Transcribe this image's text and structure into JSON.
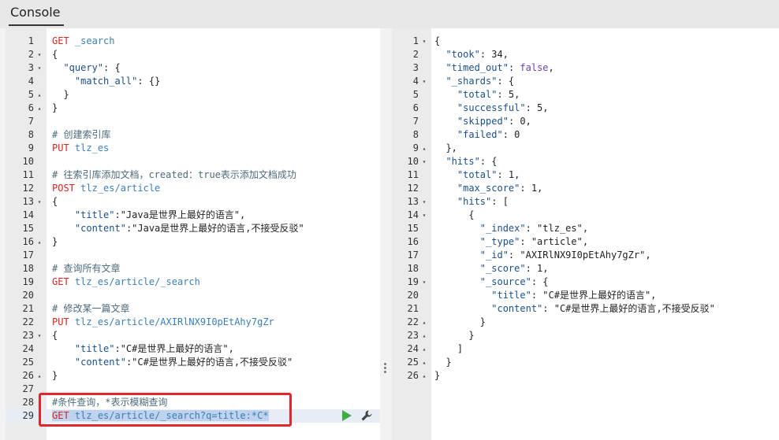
{
  "console": {
    "tab_label": "Console"
  },
  "editor": {
    "lines": [
      {
        "n": "1",
        "fold": "",
        "parts": [
          [
            "m",
            "GET"
          ],
          [
            "s",
            " "
          ],
          [
            "u",
            "_search"
          ]
        ]
      },
      {
        "n": "2",
        "fold": "▾",
        "parts": [
          [
            "s",
            "{"
          ]
        ]
      },
      {
        "n": "3",
        "fold": "▾",
        "parts": [
          [
            "s",
            "  "
          ],
          [
            "k",
            "\"query\""
          ],
          [
            "s",
            ": {"
          ]
        ]
      },
      {
        "n": "4",
        "fold": "",
        "parts": [
          [
            "s",
            "    "
          ],
          [
            "k",
            "\"match_all\""
          ],
          [
            "s",
            ": {}"
          ]
        ]
      },
      {
        "n": "5",
        "fold": "▴",
        "parts": [
          [
            "s",
            "  }"
          ]
        ]
      },
      {
        "n": "6",
        "fold": "▴",
        "parts": [
          [
            "s",
            "}"
          ]
        ]
      },
      {
        "n": "7",
        "fold": "",
        "parts": []
      },
      {
        "n": "8",
        "fold": "",
        "parts": [
          [
            "c",
            "# 创建索引库"
          ]
        ]
      },
      {
        "n": "9",
        "fold": "",
        "parts": [
          [
            "m",
            "PUT"
          ],
          [
            "s",
            " "
          ],
          [
            "u",
            "tlz_es"
          ]
        ]
      },
      {
        "n": "10",
        "fold": "",
        "parts": []
      },
      {
        "n": "11",
        "fold": "",
        "parts": [
          [
            "c",
            "# 往索引库添加文档，created：true表示添加文档成功"
          ]
        ]
      },
      {
        "n": "12",
        "fold": "",
        "parts": [
          [
            "m",
            "POST"
          ],
          [
            "s",
            " "
          ],
          [
            "u",
            "tlz_es/article"
          ]
        ]
      },
      {
        "n": "13",
        "fold": "▾",
        "parts": [
          [
            "s",
            "{"
          ]
        ]
      },
      {
        "n": "14",
        "fold": "",
        "parts": [
          [
            "s",
            "    "
          ],
          [
            "k",
            "\"title\""
          ],
          [
            "s",
            ":\"Java是世界上最好的语言\","
          ]
        ]
      },
      {
        "n": "15",
        "fold": "",
        "parts": [
          [
            "s",
            "    "
          ],
          [
            "k",
            "\"content\""
          ],
          [
            "s",
            ":\"Java是世界上最好的语言,不接受反驳\""
          ]
        ]
      },
      {
        "n": "16",
        "fold": "▴",
        "parts": [
          [
            "s",
            "}"
          ]
        ]
      },
      {
        "n": "17",
        "fold": "",
        "parts": []
      },
      {
        "n": "18",
        "fold": "",
        "parts": [
          [
            "c",
            "# 查询所有文章"
          ]
        ]
      },
      {
        "n": "19",
        "fold": "",
        "parts": [
          [
            "m",
            "GET"
          ],
          [
            "s",
            " "
          ],
          [
            "u",
            "tlz_es/article/_search"
          ]
        ]
      },
      {
        "n": "20",
        "fold": "",
        "parts": []
      },
      {
        "n": "21",
        "fold": "",
        "parts": [
          [
            "c",
            "# 修改某一篇文章"
          ]
        ]
      },
      {
        "n": "22",
        "fold": "",
        "parts": [
          [
            "m",
            "PUT"
          ],
          [
            "s",
            " "
          ],
          [
            "u",
            "tlz_es/article/AXIRlNX9I0pEtAhy7gZr"
          ]
        ]
      },
      {
        "n": "23",
        "fold": "▾",
        "parts": [
          [
            "s",
            "{"
          ]
        ]
      },
      {
        "n": "24",
        "fold": "",
        "parts": [
          [
            "s",
            "    "
          ],
          [
            "k",
            "\"title\""
          ],
          [
            "s",
            ":\"C#是世界上最好的语言\","
          ]
        ]
      },
      {
        "n": "25",
        "fold": "",
        "parts": [
          [
            "s",
            "    "
          ],
          [
            "k",
            "\"content\""
          ],
          [
            "s",
            ":\"C#是世界上最好的语言,不接受反驳\""
          ]
        ]
      },
      {
        "n": "26",
        "fold": "▴",
        "parts": [
          [
            "s",
            "}"
          ]
        ]
      },
      {
        "n": "27",
        "fold": "",
        "parts": []
      },
      {
        "n": "28",
        "fold": "",
        "parts": [
          [
            "c",
            "#条件查询，*表示模糊查询"
          ]
        ]
      },
      {
        "n": "29",
        "fold": "",
        "parts": [
          [
            "m",
            "GET"
          ],
          [
            "s",
            " "
          ],
          [
            "u",
            "tlz_es/article/_search?q=title:*C*"
          ]
        ],
        "active": true
      }
    ]
  },
  "output": {
    "lines": [
      {
        "n": "1",
        "fold": "▾",
        "parts": [
          [
            "s",
            "{"
          ]
        ]
      },
      {
        "n": "2",
        "fold": "",
        "parts": [
          [
            "s",
            "  "
          ],
          [
            "k",
            "\"took\""
          ],
          [
            "s",
            ": 34,"
          ]
        ]
      },
      {
        "n": "3",
        "fold": "",
        "parts": [
          [
            "s",
            "  "
          ],
          [
            "k",
            "\"timed_out\""
          ],
          [
            "s",
            ": "
          ],
          [
            "b",
            "false"
          ],
          [
            "s",
            ","
          ]
        ]
      },
      {
        "n": "4",
        "fold": "▾",
        "parts": [
          [
            "s",
            "  "
          ],
          [
            "k",
            "\"_shards\""
          ],
          [
            "s",
            ": {"
          ]
        ]
      },
      {
        "n": "5",
        "fold": "",
        "parts": [
          [
            "s",
            "    "
          ],
          [
            "k",
            "\"total\""
          ],
          [
            "s",
            ": 5,"
          ]
        ]
      },
      {
        "n": "6",
        "fold": "",
        "parts": [
          [
            "s",
            "    "
          ],
          [
            "k",
            "\"successful\""
          ],
          [
            "s",
            ": 5,"
          ]
        ]
      },
      {
        "n": "7",
        "fold": "",
        "parts": [
          [
            "s",
            "    "
          ],
          [
            "k",
            "\"skipped\""
          ],
          [
            "s",
            ": 0,"
          ]
        ]
      },
      {
        "n": "8",
        "fold": "",
        "parts": [
          [
            "s",
            "    "
          ],
          [
            "k",
            "\"failed\""
          ],
          [
            "s",
            ": 0"
          ]
        ]
      },
      {
        "n": "9",
        "fold": "▴",
        "parts": [
          [
            "s",
            "  },"
          ]
        ]
      },
      {
        "n": "10",
        "fold": "▾",
        "parts": [
          [
            "s",
            "  "
          ],
          [
            "k",
            "\"hits\""
          ],
          [
            "s",
            ": {"
          ]
        ]
      },
      {
        "n": "11",
        "fold": "",
        "parts": [
          [
            "s",
            "    "
          ],
          [
            "k",
            "\"total\""
          ],
          [
            "s",
            ": 1,"
          ]
        ]
      },
      {
        "n": "12",
        "fold": "",
        "parts": [
          [
            "s",
            "    "
          ],
          [
            "k",
            "\"max_score\""
          ],
          [
            "s",
            ": 1,"
          ]
        ]
      },
      {
        "n": "13",
        "fold": "▾",
        "parts": [
          [
            "s",
            "    "
          ],
          [
            "k",
            "\"hits\""
          ],
          [
            "s",
            ": ["
          ]
        ]
      },
      {
        "n": "14",
        "fold": "▾",
        "parts": [
          [
            "s",
            "      {"
          ]
        ]
      },
      {
        "n": "15",
        "fold": "",
        "parts": [
          [
            "s",
            "        "
          ],
          [
            "k",
            "\"_index\""
          ],
          [
            "s",
            ": \"tlz_es\","
          ]
        ]
      },
      {
        "n": "16",
        "fold": "",
        "parts": [
          [
            "s",
            "        "
          ],
          [
            "k",
            "\"_type\""
          ],
          [
            "s",
            ": \"article\","
          ]
        ]
      },
      {
        "n": "17",
        "fold": "",
        "parts": [
          [
            "s",
            "        "
          ],
          [
            "k",
            "\"_id\""
          ],
          [
            "s",
            ": \"AXIRlNX9I0pEtAhy7gZr\","
          ]
        ]
      },
      {
        "n": "18",
        "fold": "",
        "parts": [
          [
            "s",
            "        "
          ],
          [
            "k",
            "\"_score\""
          ],
          [
            "s",
            ": 1,"
          ]
        ]
      },
      {
        "n": "19",
        "fold": "▾",
        "parts": [
          [
            "s",
            "        "
          ],
          [
            "k",
            "\"_source\""
          ],
          [
            "s",
            ": {"
          ]
        ]
      },
      {
        "n": "20",
        "fold": "",
        "parts": [
          [
            "s",
            "          "
          ],
          [
            "k",
            "\"title\""
          ],
          [
            "s",
            ": \"C#是世界上最好的语言\","
          ]
        ]
      },
      {
        "n": "21",
        "fold": "",
        "parts": [
          [
            "s",
            "          "
          ],
          [
            "k",
            "\"content\""
          ],
          [
            "s",
            ": \"C#是世界上最好的语言,不接受反驳\""
          ]
        ]
      },
      {
        "n": "22",
        "fold": "▴",
        "parts": [
          [
            "s",
            "        }"
          ]
        ]
      },
      {
        "n": "23",
        "fold": "▴",
        "parts": [
          [
            "s",
            "      }"
          ]
        ]
      },
      {
        "n": "24",
        "fold": "▴",
        "parts": [
          [
            "s",
            "    ]"
          ]
        ]
      },
      {
        "n": "25",
        "fold": "▴",
        "parts": [
          [
            "s",
            "  }"
          ]
        ]
      },
      {
        "n": "26",
        "fold": "▴",
        "parts": [
          [
            "s",
            "}"
          ]
        ]
      }
    ]
  },
  "colors": {
    "method": "#dd2222",
    "url": "#3b7fb5",
    "comment": "#4d6a7a",
    "key": "#1b4f8a",
    "highlight_border": "#e3262c",
    "run_green": "#3eab45"
  },
  "icons": {
    "run": "play-icon",
    "settings": "wrench-icon",
    "resize": "drag-handle-icon"
  }
}
